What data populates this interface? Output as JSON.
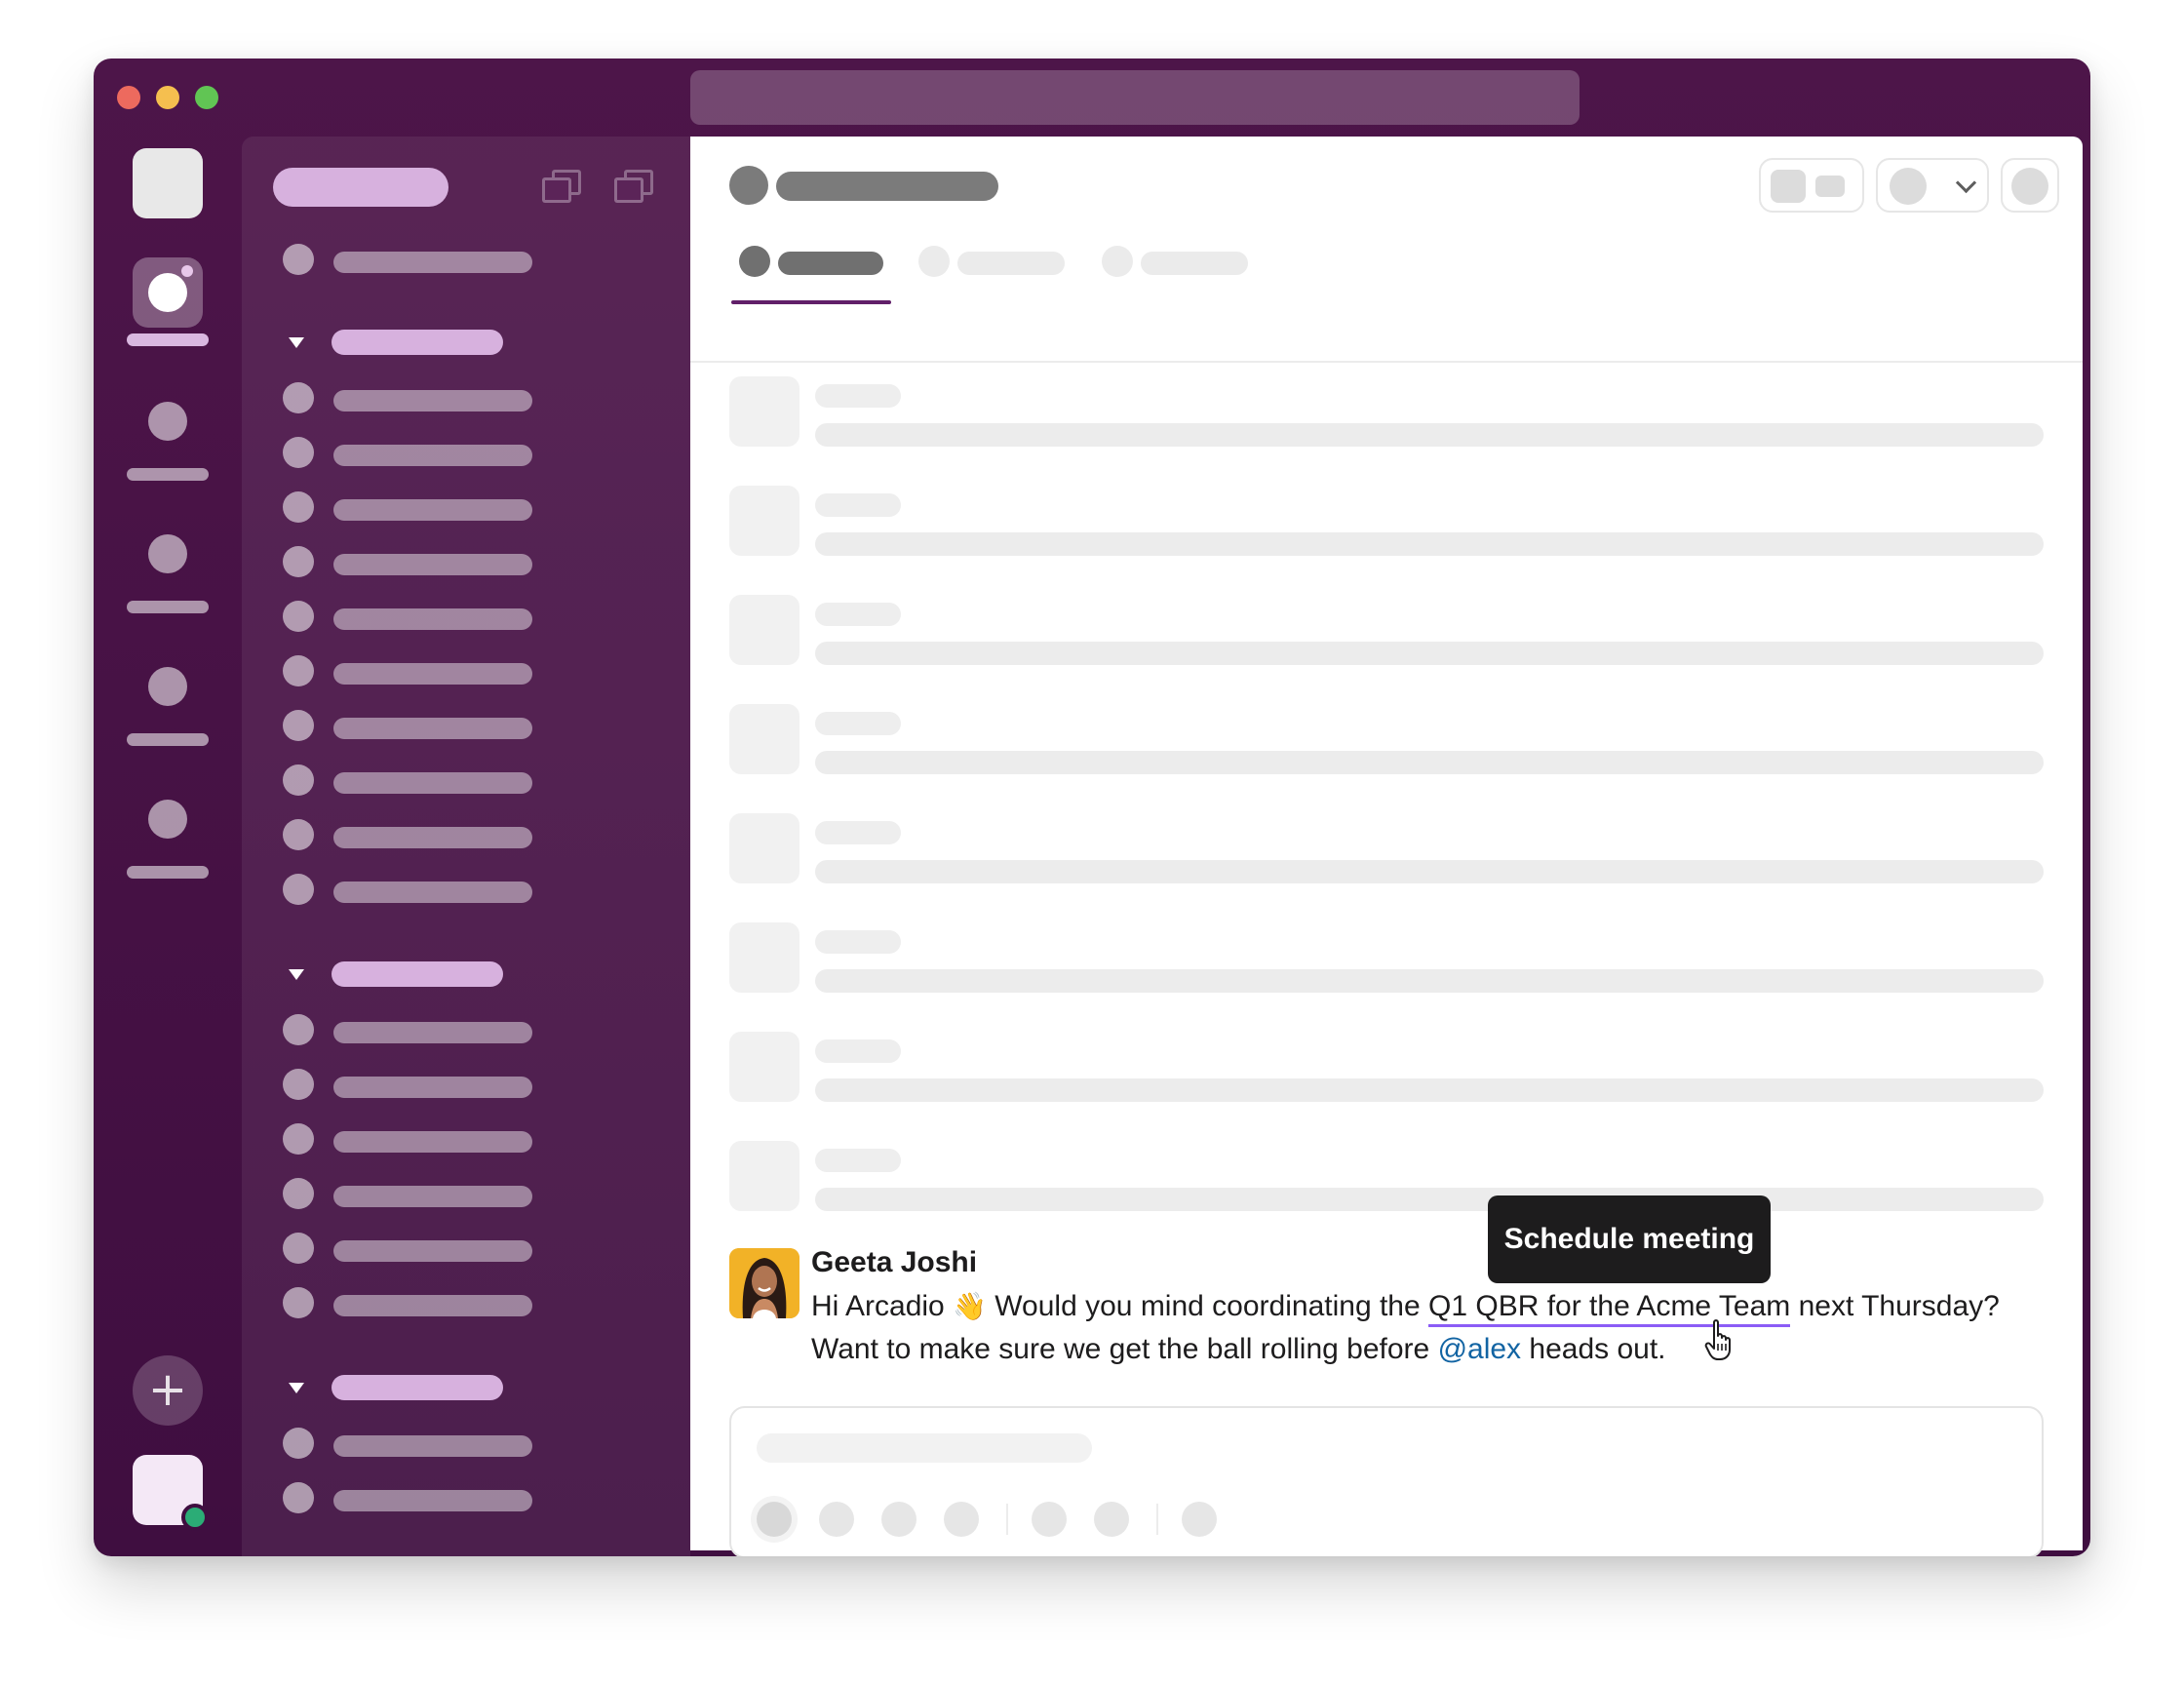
{
  "window": {
    "controls": [
      "close",
      "minimize",
      "zoom"
    ]
  },
  "message": {
    "author": "Geeta Joshi",
    "text_before": "Hi Arcadio ",
    "emoji": "👋",
    "text_middle": " Would you mind coordinating the ",
    "link_text": "Q1 QBR for the Acme Team",
    "text_after": " next Thursday?",
    "line2_before": "Want to make sure we get the ball rolling before ",
    "mention": "@alex",
    "line2_after": " heads out."
  },
  "tooltip": {
    "label": "Schedule meeting"
  },
  "colors": {
    "aubergine": "#3f0e40",
    "link_underline": "#8b5cf6",
    "mention": "#1264a3",
    "online": "#2bac76",
    "tooltip_bg": "#1d1c1d"
  },
  "icons": {
    "add": "+",
    "collapse": "triangle-down",
    "dropdown": "chevron-down",
    "cursor": "hand-pointer"
  }
}
